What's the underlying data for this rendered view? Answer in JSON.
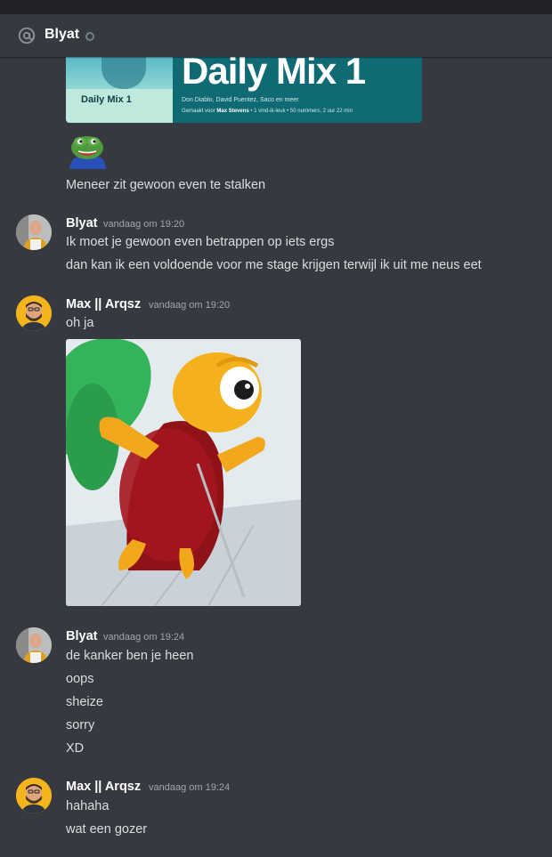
{
  "header": {
    "channel_icon": "at-icon",
    "title": "Blyat",
    "status_icon": "offline-status-icon"
  },
  "embed": {
    "cover_label": "Daily Mix 1",
    "title": "Daily Mix 1",
    "artists": "Don Diablo, David Puentez, Saco en meer",
    "made_for_prefix": "Gemaakt voor ",
    "made_for_user": "Max Stevens",
    "stats": " • 1 vind-ik-leuk • 50 nummers, 2 uur 22 min"
  },
  "messages": {
    "m0": {
      "text": "Meneer zit gewoon even te stalken"
    },
    "g1": {
      "author": "Blyat",
      "timestamp": "vandaag om 19:20",
      "lines": [
        "Ik moet je gewoon even  betrappen op iets ergs",
        "dan kan ik een voldoende voor me stage krijgen terwijl ik uit me neus eet"
      ]
    },
    "g2": {
      "author": "Max || Arqsz",
      "timestamp": "vandaag om 19:20",
      "lines": [
        "oh ja"
      ]
    },
    "g3": {
      "author": "Blyat",
      "timestamp": "vandaag om 19:24",
      "lines": [
        "de kanker ben je heen",
        "oops",
        "sheize",
        "sorry",
        "XD"
      ]
    },
    "g4": {
      "author": "Max || Arqsz",
      "timestamp": "vandaag om 19:24",
      "lines": [
        "hahaha",
        "wat een gozer"
      ]
    }
  },
  "colors": {
    "background": "#36393f",
    "text": "#dcddde",
    "author": "#ffffff",
    "timestamp": "#a3a6aa"
  }
}
